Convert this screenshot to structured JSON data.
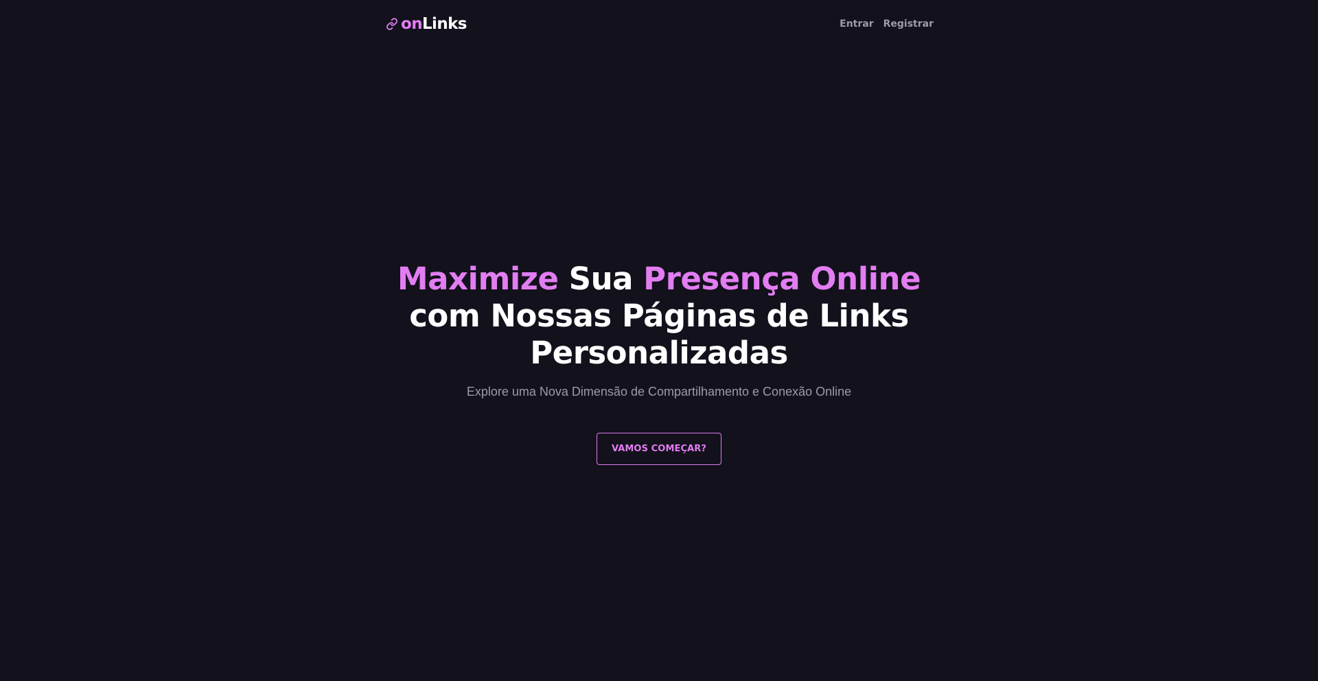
{
  "brand": {
    "icon": "link-icon",
    "name_part1": "on",
    "name_part2": "Links"
  },
  "nav": {
    "login_label": "Entrar",
    "register_label": "Registrar"
  },
  "hero": {
    "title_word1": "Maximize",
    "title_word2": "Sua",
    "title_word3": "Presença Online",
    "title_rest": "com Nossas Páginas de Links Personalizadas",
    "subtitle": "Explore uma Nova Dimensão de Compartilhamento e Conexão Online",
    "cta_label": "VAMOS COMEÇAR?"
  },
  "colors": {
    "background": "#13111c",
    "accent": "#e27df2",
    "text": "#ffffff",
    "muted": "#9e9aaa"
  }
}
